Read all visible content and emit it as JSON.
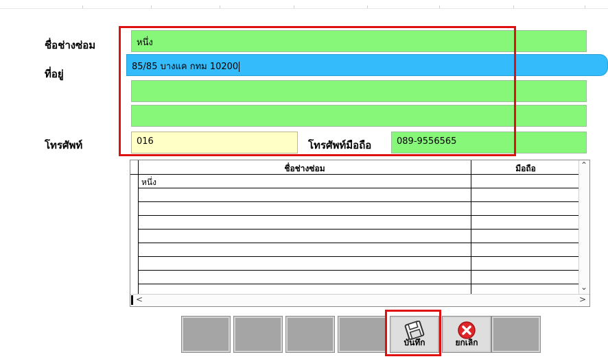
{
  "labels": {
    "technician_name": "ชื่อช่างซ่อม",
    "address": "ที่อยู่",
    "phone": "โทรศัพท์",
    "mobile": "โทรศัพท์มือถือ"
  },
  "fields": {
    "technician_name": "หนึ่ง",
    "address_1": "85/85 บางแค กทม 10200",
    "address_2": "",
    "address_3": "",
    "phone": "016",
    "mobile": "089-9556565"
  },
  "grid": {
    "columns": [
      "ชื่อช่างซ่อม",
      "มือถือ"
    ],
    "rows": [
      [
        "หนึ่ง",
        ""
      ],
      [
        "",
        ""
      ],
      [
        "",
        ""
      ],
      [
        "",
        ""
      ],
      [
        "",
        ""
      ],
      [
        "",
        ""
      ],
      [
        "",
        ""
      ],
      [
        "",
        ""
      ],
      [
        "",
        ""
      ]
    ]
  },
  "buttons": {
    "save": "บันทึก",
    "cancel": "ยกเลิก"
  },
  "colors": {
    "field_green": "#86f779",
    "field_active": "#33bbfb",
    "field_yellow": "#ffffc6",
    "annotation_red": "#e01010"
  }
}
